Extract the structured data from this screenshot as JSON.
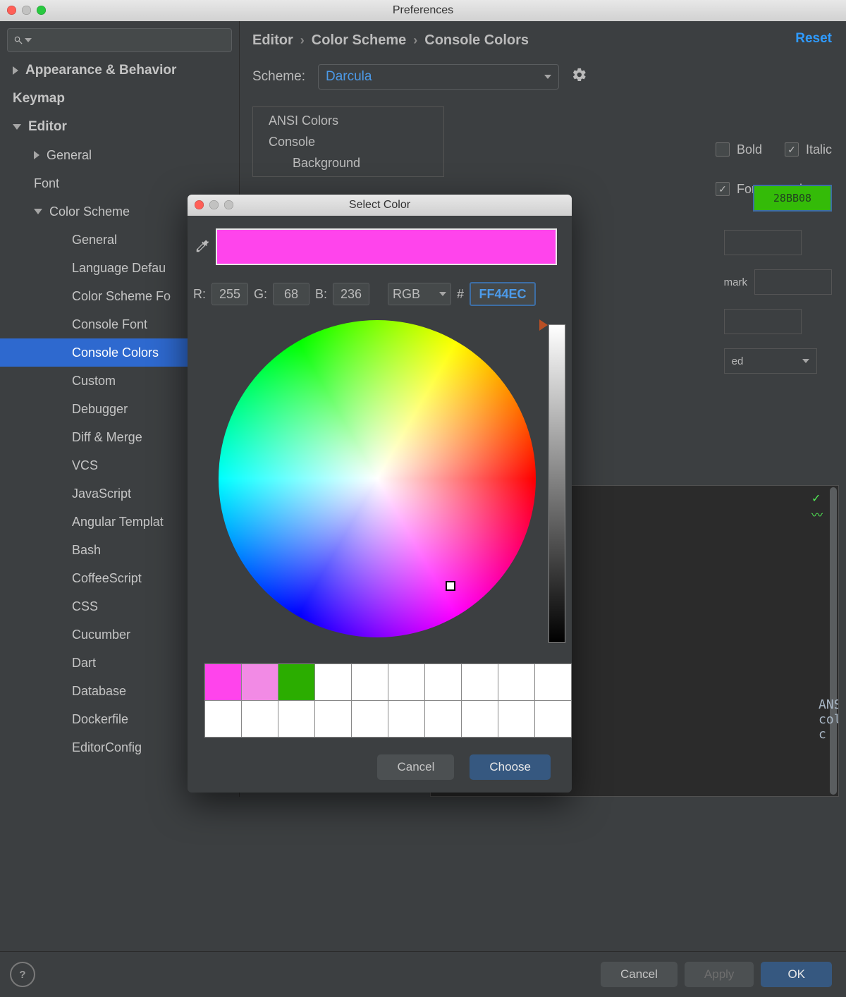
{
  "window_title": "Preferences",
  "sidebar": {
    "items": [
      {
        "label": "Appearance & Behavior",
        "bold": true,
        "arrow": "right",
        "indent": 0
      },
      {
        "label": "Keymap",
        "bold": true,
        "indent": 0
      },
      {
        "label": "Editor",
        "bold": true,
        "arrow": "down",
        "indent": 0
      },
      {
        "label": "General",
        "arrow": "right",
        "indent": 1
      },
      {
        "label": "Font",
        "indent": 1
      },
      {
        "label": "Color Scheme",
        "arrow": "down",
        "indent": 1
      },
      {
        "label": "General",
        "indent": 2
      },
      {
        "label": "Language Defau",
        "indent": 2
      },
      {
        "label": "Color Scheme Fo",
        "indent": 2
      },
      {
        "label": "Console Font",
        "indent": 2
      },
      {
        "label": "Console Colors",
        "indent": 2,
        "selected": true
      },
      {
        "label": "Custom",
        "indent": 2
      },
      {
        "label": "Debugger",
        "indent": 2
      },
      {
        "label": "Diff & Merge",
        "indent": 2
      },
      {
        "label": "VCS",
        "indent": 2
      },
      {
        "label": "JavaScript",
        "indent": 2
      },
      {
        "label": "Angular Templat",
        "indent": 2
      },
      {
        "label": "Bash",
        "indent": 2
      },
      {
        "label": "CoffeeScript",
        "indent": 2
      },
      {
        "label": "CSS",
        "indent": 2
      },
      {
        "label": "Cucumber",
        "indent": 2
      },
      {
        "label": "Dart",
        "indent": 2
      },
      {
        "label": "Database",
        "indent": 2
      },
      {
        "label": "Dockerfile",
        "indent": 2
      },
      {
        "label": "EditorConfig",
        "indent": 2
      }
    ]
  },
  "breadcrumb": [
    "Editor",
    "Color Scheme",
    "Console Colors"
  ],
  "reset_label": "Reset",
  "scheme_label": "Scheme:",
  "scheme_value": "Darcula",
  "settings_tree": {
    "ansi": "ANSI Colors",
    "console": "Console",
    "background": "Background"
  },
  "opts": {
    "bold": "Bold",
    "italic": "Italic",
    "foreground": "Foreground",
    "fg_color_label": "28BB08",
    "mark": "mark",
    "inherited": "ed"
  },
  "preview_text": "ANSI colors c",
  "buttons": {
    "cancel": "Cancel",
    "apply": "Apply",
    "ok": "OK"
  },
  "colorpicker": {
    "title": "Select Color",
    "r_label": "R:",
    "g_label": "G:",
    "b_label": "B:",
    "r": "255",
    "g": "68",
    "b": "236",
    "mode": "RGB",
    "hash": "#",
    "hex": "FF44EC",
    "preset_colors": [
      "#ff44ec",
      "#f28ae5",
      "#2bad00"
    ],
    "cancel": "Cancel",
    "choose": "Choose"
  }
}
